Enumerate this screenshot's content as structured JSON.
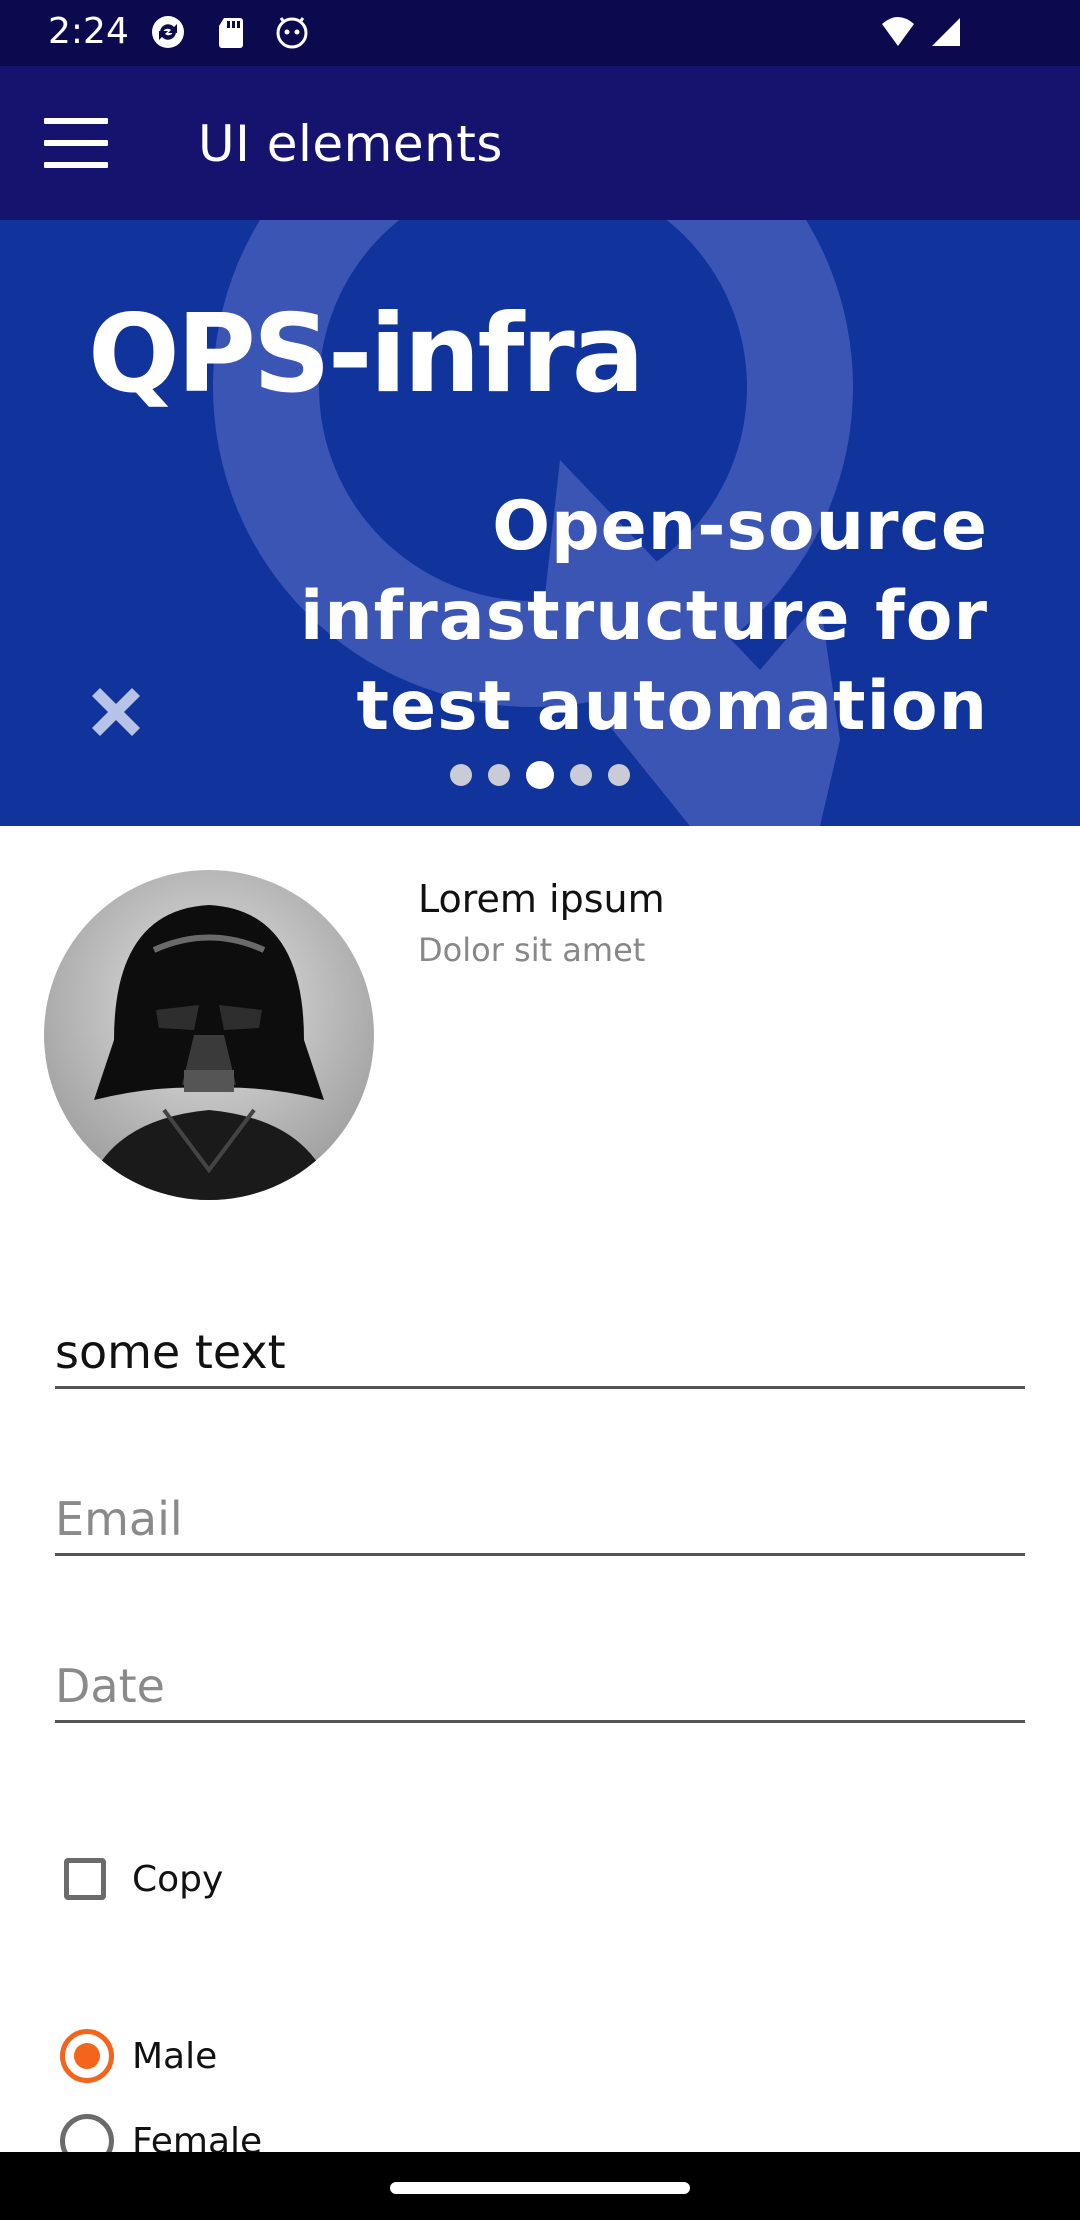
{
  "status_bar": {
    "time": "2:24",
    "icons": [
      "sync-icon",
      "sd-card-icon",
      "android-debug-icon"
    ],
    "right_icons": [
      "wifi-icon",
      "cell-signal-icon"
    ]
  },
  "app_bar": {
    "menu_icon": "hamburger-menu-icon",
    "title": "UI elements"
  },
  "banner": {
    "title": "QPS-infra",
    "subtitle": "Open-source infrastructure for test automation",
    "close_icon": "close-icon",
    "page_count": 5,
    "active_page": 3
  },
  "card": {
    "title": "Lorem ipsum",
    "subtitle": "Dolor sit amet"
  },
  "form": {
    "text_value": "some text",
    "email_placeholder": "Email",
    "date_placeholder": "Date",
    "checkbox_label": "Copy",
    "checkbox_checked": false,
    "radio_options": [
      {
        "label": "Male",
        "checked": true
      },
      {
        "label": "Female",
        "checked": false
      }
    ]
  },
  "colors": {
    "status_bar": "#0c0a4e",
    "app_bar": "#16136e",
    "banner": "#11349c",
    "accent": "#f3641d"
  }
}
